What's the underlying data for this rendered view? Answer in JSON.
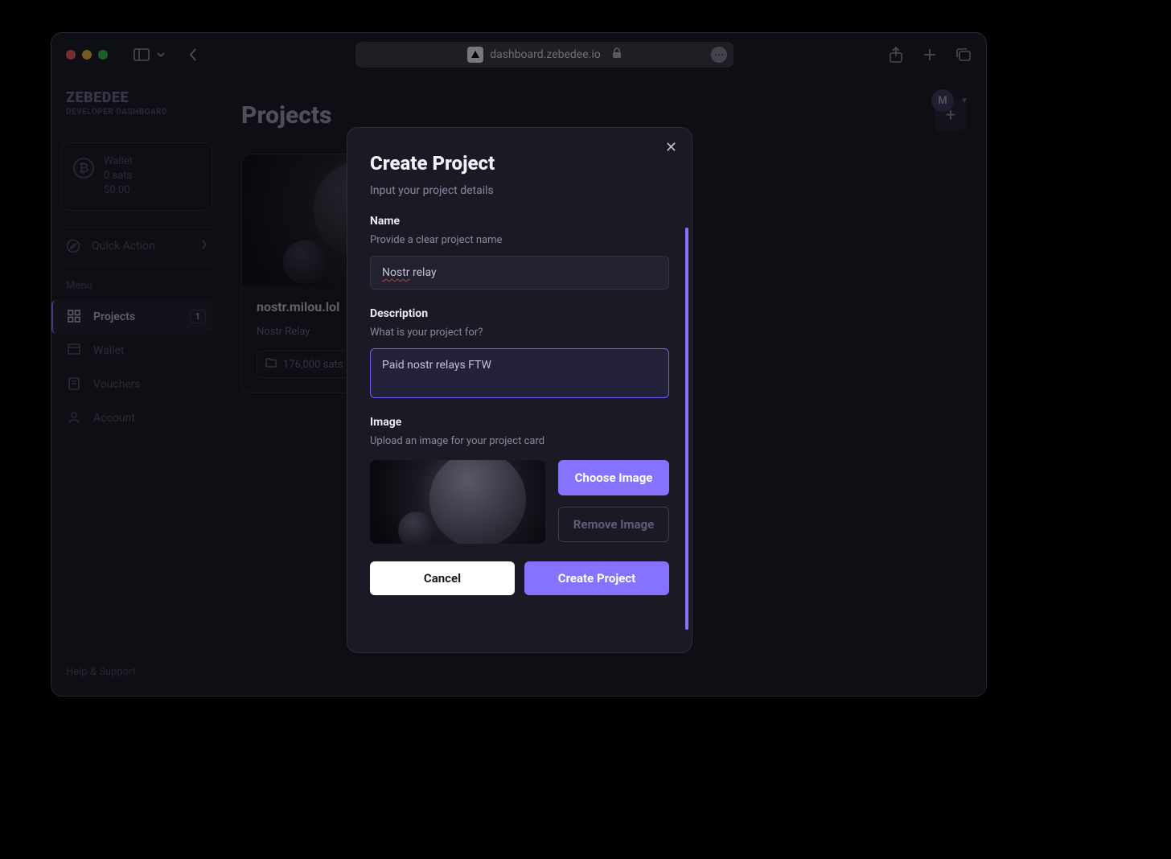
{
  "browser": {
    "url": "dashboard.zebedee.io"
  },
  "brand": {
    "logo": "ZEBEDEE",
    "subtitle": "DEVELOPER DASHBOARD"
  },
  "wallet": {
    "label": "Wallet",
    "sats": "0 sats",
    "usd": "$0.00"
  },
  "quick_action_label": "Quick Action",
  "menu": {
    "label": "Menu",
    "items": [
      {
        "label": "Projects",
        "badge": "1",
        "active": true
      },
      {
        "label": "Wallet"
      },
      {
        "label": "Vouchers"
      },
      {
        "label": "Account"
      }
    ]
  },
  "help_label": "Help & Support",
  "main": {
    "title": "Projects"
  },
  "project_card": {
    "name": "nostr.milou.lol",
    "sub": "Nostr Relay",
    "sats": "176,000 sats"
  },
  "avatar_letter": "M",
  "modal": {
    "title": "Create Project",
    "subtitle": "Input your project details",
    "name_label": "Name",
    "name_help": "Provide a clear project name",
    "name_value_spell": "Nostr",
    "name_value_rest": " relay",
    "desc_label": "Description",
    "desc_help": "What is your project for?",
    "desc_value": "Paid nostr relays FTW",
    "image_label": "Image",
    "image_help": "Upload an image for your project card",
    "choose_image": "Choose Image",
    "remove_image": "Remove Image",
    "cancel": "Cancel",
    "create": "Create Project"
  }
}
